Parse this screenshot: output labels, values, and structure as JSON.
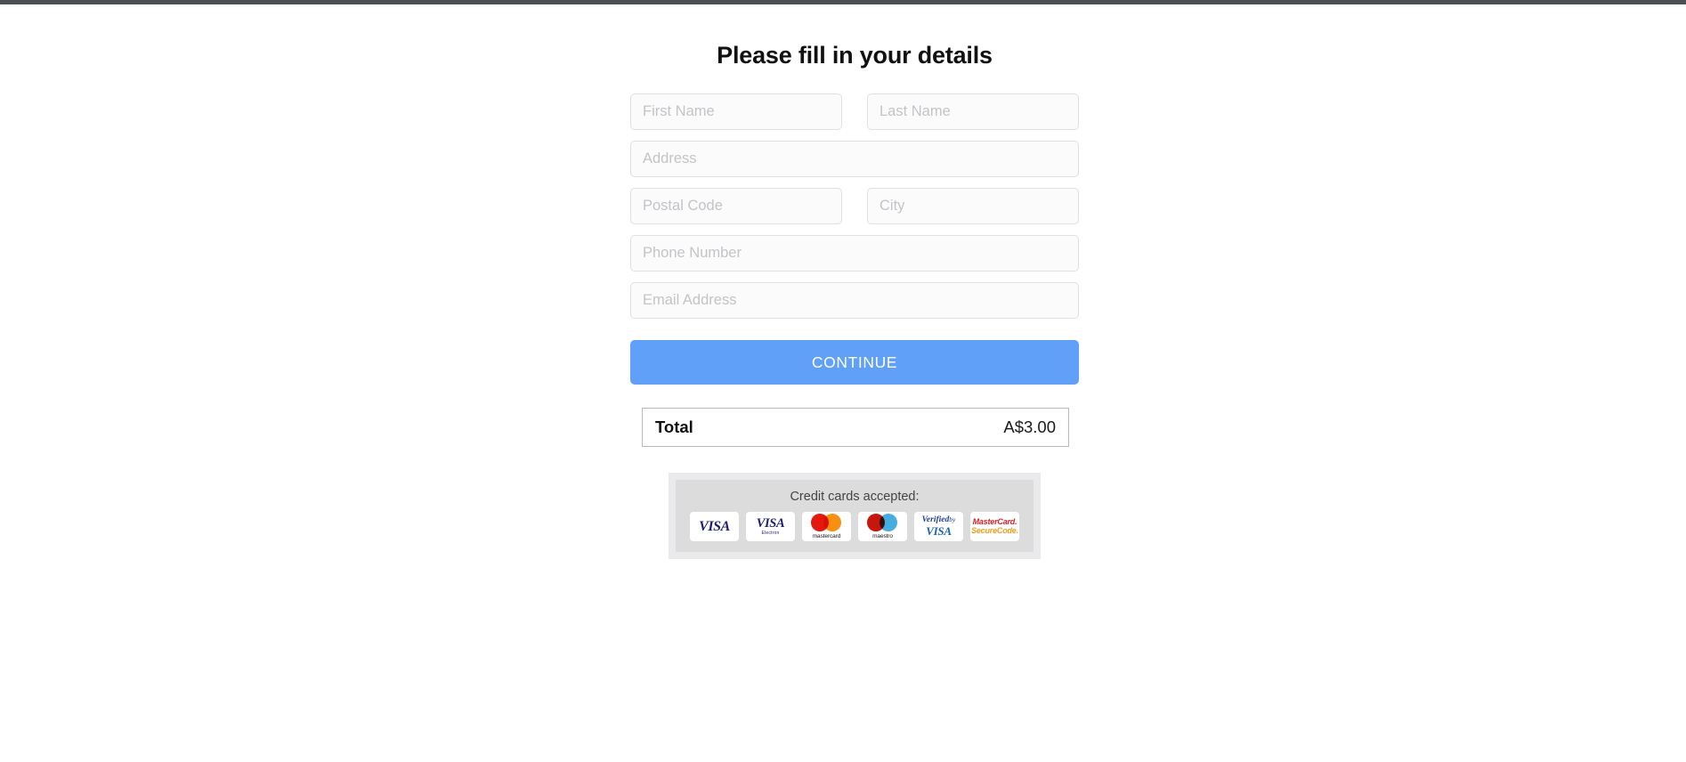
{
  "colors": {
    "accent_button": "#60a0f8",
    "top_bar": "#4c4f53",
    "panel_outer": "#eaeaec",
    "panel_inner": "#dcdcdc",
    "field_border": "#e0e1e6",
    "placeholder": "#c4c4c8",
    "visa_blue": "#1a1f71",
    "mastercard_red": "#e4180f",
    "mastercard_orange": "#f79010",
    "maestro_blue": "#45aee0",
    "securecode_orange": "#f59b1c"
  },
  "header": {
    "title": "Please fill in your details"
  },
  "form": {
    "fields": [
      {
        "name": "first-name",
        "placeholder": "First Name",
        "value": "",
        "width": "half"
      },
      {
        "name": "last-name",
        "placeholder": "Last Name",
        "value": "",
        "width": "half"
      },
      {
        "name": "address",
        "placeholder": "Address",
        "value": "",
        "width": "full"
      },
      {
        "name": "postal-code",
        "placeholder": "Postal Code",
        "value": "",
        "width": "half"
      },
      {
        "name": "city",
        "placeholder": "City",
        "value": "",
        "width": "half"
      },
      {
        "name": "phone-number",
        "placeholder": "Phone Number",
        "value": "",
        "width": "full"
      },
      {
        "name": "email-address",
        "placeholder": "Email Address",
        "value": "",
        "width": "full"
      }
    ],
    "submit_label": "CONTINUE"
  },
  "summary": {
    "total_label": "Total",
    "total_amount": "A$3.00"
  },
  "payment": {
    "caption": "Credit cards accepted:",
    "logos": [
      {
        "icon": "visa-logo-icon",
        "line1": "VISA",
        "line2": ""
      },
      {
        "icon": "visa-electron-logo-icon",
        "line1": "VISA",
        "line2": "Electron"
      },
      {
        "icon": "mastercard-logo-icon",
        "line1": "",
        "line2": "mastercard"
      },
      {
        "icon": "maestro-logo-icon",
        "line1": "",
        "line2": "maestro"
      },
      {
        "icon": "verified-by-visa-logo-icon",
        "line1": "Verified",
        "line2": "VISA",
        "line1_suffix": "by"
      },
      {
        "icon": "mastercard-securecode-logo-icon",
        "line1": "MasterCard.",
        "line2": "SecureCode."
      }
    ]
  }
}
